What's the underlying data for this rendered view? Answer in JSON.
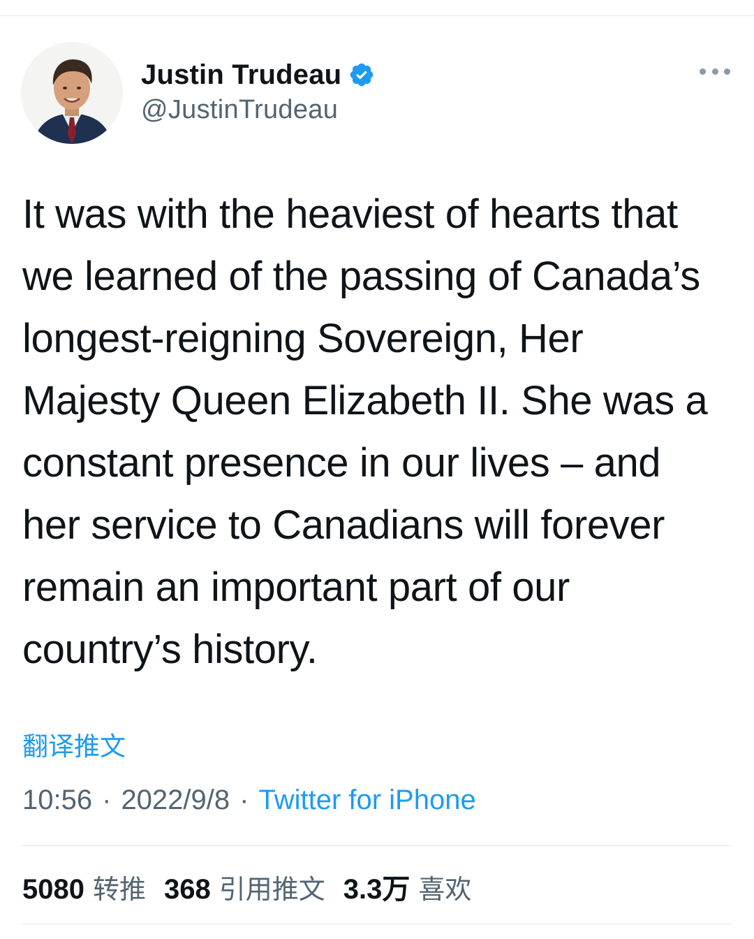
{
  "author": {
    "display_name": "Justin Trudeau",
    "handle": "@JustinTrudeau",
    "verified": true
  },
  "tweet": {
    "lines": [
      "It was with the heaviest of hearts that",
      "we learned of the passing of Canada’s",
      "longest-reigning Sovereign, Her",
      "Majesty Queen Elizabeth II. She was a",
      "constant presence in our lives – and",
      "her service to Canadians will forever",
      "remain an important part of our",
      "country’s history."
    ],
    "translate_label": "翻译推文"
  },
  "meta": {
    "time": "10:56",
    "date": "2022/9/8",
    "separator": "·",
    "source": "Twitter for iPhone"
  },
  "stats": {
    "retweets": {
      "count": "5080",
      "label": "转推"
    },
    "quotes": {
      "count": "368",
      "label": "引用推文"
    },
    "likes": {
      "count": "3.3万",
      "label": "喜欢"
    }
  },
  "colors": {
    "link": "#1d9bf0",
    "secondary_text": "#536471",
    "primary_text": "#0f1419",
    "verified_badge": "#1d9bf0"
  },
  "icons": [
    "verified-badge-icon",
    "more-options-icon"
  ]
}
